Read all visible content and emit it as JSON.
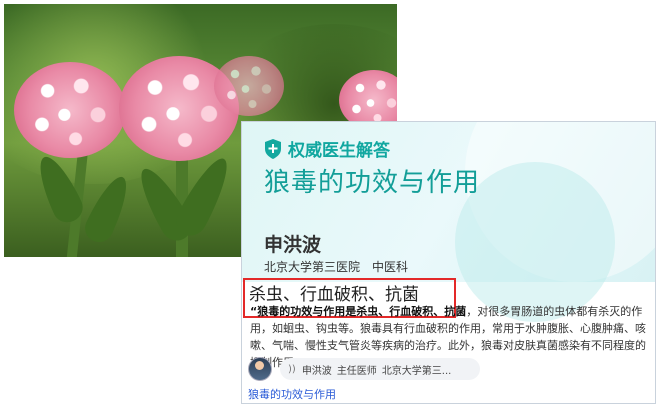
{
  "card": {
    "badge": "权威医生解答",
    "title": "狼毒的功效与作用",
    "doctor_name": "申洪波",
    "hospital": "北京大学第三医院",
    "department": "中医科"
  },
  "answer": {
    "headline": "杀虫、行血破积、抗菌",
    "bold_lead": "“狼毒的功效与作用是杀虫、行血破积、抗菌",
    "body": "，对很多胃肠道的虫体都有杀灭的作用，如蛔虫、钩虫等。狼毒具有行血破积的作用，常用于水肿腹胀、心腹肿痛、咳嗽、气喘、慢性支气管炎等疾病的治疗。此外，狼毒对皮肤真菌感染有不同程度的抑制作用。”"
  },
  "doctor_strip": {
    "name": "申洪波",
    "title": "主任医师",
    "hospital_short": "北京大学第三..."
  },
  "footer_link": "狼毒的功效与作用",
  "colors": {
    "accent": "#139e98",
    "highlight_box": "#e32929",
    "link": "#2a5bd7"
  },
  "icons": {
    "badge": "shield-plus-icon",
    "audio": "audio-wave-icon"
  }
}
